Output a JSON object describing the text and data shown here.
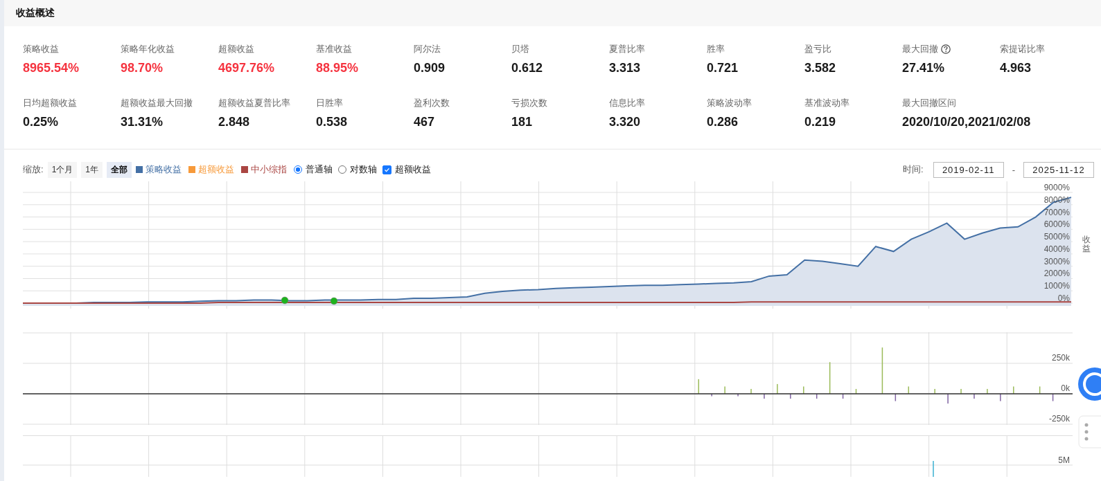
{
  "section_title": "收益概述",
  "metrics": [
    {
      "label": "策略收益",
      "value": "8965.54%",
      "color": "#f5333f"
    },
    {
      "label": "策略年化收益",
      "value": "98.70%",
      "color": "#f5333f"
    },
    {
      "label": "超额收益",
      "value": "4697.76%",
      "color": "#f5333f"
    },
    {
      "label": "基准收益",
      "value": "88.95%",
      "color": "#f5333f"
    },
    {
      "label": "阿尔法",
      "value": "0.909",
      "color": "#1a1a1a"
    },
    {
      "label": "贝塔",
      "value": "0.612",
      "color": "#1a1a1a"
    },
    {
      "label": "夏普比率",
      "value": "3.313",
      "color": "#1a1a1a"
    },
    {
      "label": "胜率",
      "value": "0.721",
      "color": "#1a1a1a"
    },
    {
      "label": "盈亏比",
      "value": "3.582",
      "color": "#1a1a1a"
    },
    {
      "label": "最大回撤",
      "value": "27.41%",
      "color": "#1a1a1a",
      "help": true
    },
    {
      "label": "索提诺比率",
      "value": "4.963",
      "color": "#1a1a1a"
    },
    {
      "label": "日均超额收益",
      "value": "0.25%",
      "color": "#1a1a1a"
    },
    {
      "label": "超额收益最大回撤",
      "value": "31.31%",
      "color": "#1a1a1a"
    },
    {
      "label": "超额收益夏普比率",
      "value": "2.848",
      "color": "#1a1a1a"
    },
    {
      "label": "日胜率",
      "value": "0.538",
      "color": "#1a1a1a"
    },
    {
      "label": "盈利次数",
      "value": "467",
      "color": "#1a1a1a"
    },
    {
      "label": "亏损次数",
      "value": "181",
      "color": "#1a1a1a"
    },
    {
      "label": "信息比率",
      "value": "3.320",
      "color": "#1a1a1a"
    },
    {
      "label": "策略波动率",
      "value": "0.286",
      "color": "#1a1a1a"
    },
    {
      "label": "基准波动率",
      "value": "0.219",
      "color": "#1a1a1a"
    },
    {
      "label": "最大回撤区间",
      "value": "2020/10/20,2021/02/08",
      "color": "#1a1a1a"
    }
  ],
  "toolbar": {
    "zoom_label": "缩放:",
    "zoom_options": [
      {
        "label": "1个月",
        "selected": false
      },
      {
        "label": "1年",
        "selected": false
      },
      {
        "label": "全部",
        "selected": true
      }
    ],
    "legend": [
      {
        "label": "策略收益",
        "color": "#4470a5"
      },
      {
        "label": "超额收益",
        "color": "#f79a3a"
      },
      {
        "label": "中小综指",
        "color": "#aa4643"
      }
    ],
    "axis_options": [
      {
        "label": "普通轴",
        "selected": true
      },
      {
        "label": "对数轴",
        "selected": false
      }
    ],
    "excess_toggle": {
      "label": "超额收益",
      "checked": true
    },
    "time_label": "时间:",
    "start_date": "2019-02-11",
    "separator": "-",
    "end_date": "2025-11-12"
  },
  "returns_chart": {
    "axis_title": "收益",
    "chart_data": {
      "type": "area",
      "grid": true,
      "ylim": [
        0,
        9000
      ],
      "yticks": [
        {
          "value": 0,
          "label": "0%"
        },
        {
          "value": 1000,
          "label": "1000%"
        },
        {
          "value": 2000,
          "label": "2000%"
        },
        {
          "value": 3000,
          "label": "3000%"
        },
        {
          "value": 4000,
          "label": "4000%"
        },
        {
          "value": 5000,
          "label": "5000%"
        },
        {
          "value": 6000,
          "label": "6000%"
        },
        {
          "value": 7000,
          "label": "7000%"
        },
        {
          "value": 8000,
          "label": "8000%"
        },
        {
          "value": 9000,
          "label": "9000%"
        }
      ],
      "series": [
        {
          "color": "#4470a5",
          "type": "area",
          "values": [
            0,
            0,
            0,
            0,
            50,
            50,
            50,
            100,
            100,
            100,
            150,
            200,
            200,
            250,
            250,
            200,
            200,
            250,
            250,
            250,
            300,
            300,
            400,
            400,
            450,
            500,
            800,
            950,
            1050,
            1100,
            1200,
            1250,
            1300,
            1350,
            1400,
            1450,
            1450,
            1500,
            1550,
            1600,
            1650,
            1750,
            2200,
            2300,
            3500,
            3400,
            3200,
            3000,
            4600,
            4200,
            5200,
            5800,
            6500,
            5200,
            5700,
            6100,
            6200,
            7000,
            8200,
            8600
          ]
        },
        {
          "color": "#aa4643",
          "type": "line",
          "values": [
            0,
            0,
            0,
            0,
            0,
            0,
            0,
            0,
            0,
            0,
            0,
            50,
            50,
            50,
            50,
            50,
            50,
            50,
            50,
            50,
            50,
            50,
            50,
            50,
            50,
            50,
            50,
            50,
            50,
            50,
            50,
            50,
            50,
            50,
            50,
            50,
            50,
            50,
            50,
            50,
            50,
            100,
            100,
            100,
            100,
            100,
            100,
            100,
            100,
            100,
            100,
            100,
            100,
            100,
            100,
            100,
            100,
            100,
            100,
            100
          ]
        }
      ]
    }
  },
  "excess_chart": {
    "chart_data": {
      "type": "bar",
      "grid": true,
      "ylim": [
        -250,
        500
      ],
      "yticks": [
        {
          "value": -250,
          "label": "-250k"
        },
        {
          "value": 0,
          "label": "0k"
        },
        {
          "value": 250,
          "label": "250k"
        }
      ],
      "values": [
        0,
        0,
        0,
        0,
        0,
        0,
        0,
        0,
        0,
        0,
        0,
        0,
        0,
        0,
        0,
        0,
        0,
        0,
        0,
        0,
        0,
        0,
        0,
        0,
        0,
        0,
        0,
        0,
        0,
        0,
        0,
        0,
        0,
        0,
        0,
        0,
        0,
        0,
        0,
        0,
        0,
        0,
        0,
        0,
        0,
        0,
        0,
        0,
        0,
        0,
        0,
        120,
        -20,
        60,
        -20,
        40,
        -40,
        80,
        -40,
        60,
        -40,
        260,
        -40,
        40,
        0,
        380,
        -60,
        60,
        0,
        40,
        -80,
        40,
        -40,
        40,
        -60,
        60,
        0,
        60,
        -60,
        0
      ]
    },
    "markers_chart": {
      "tick_label": "5M"
    }
  },
  "side_widgets": {
    "chat": true,
    "more": true
  }
}
